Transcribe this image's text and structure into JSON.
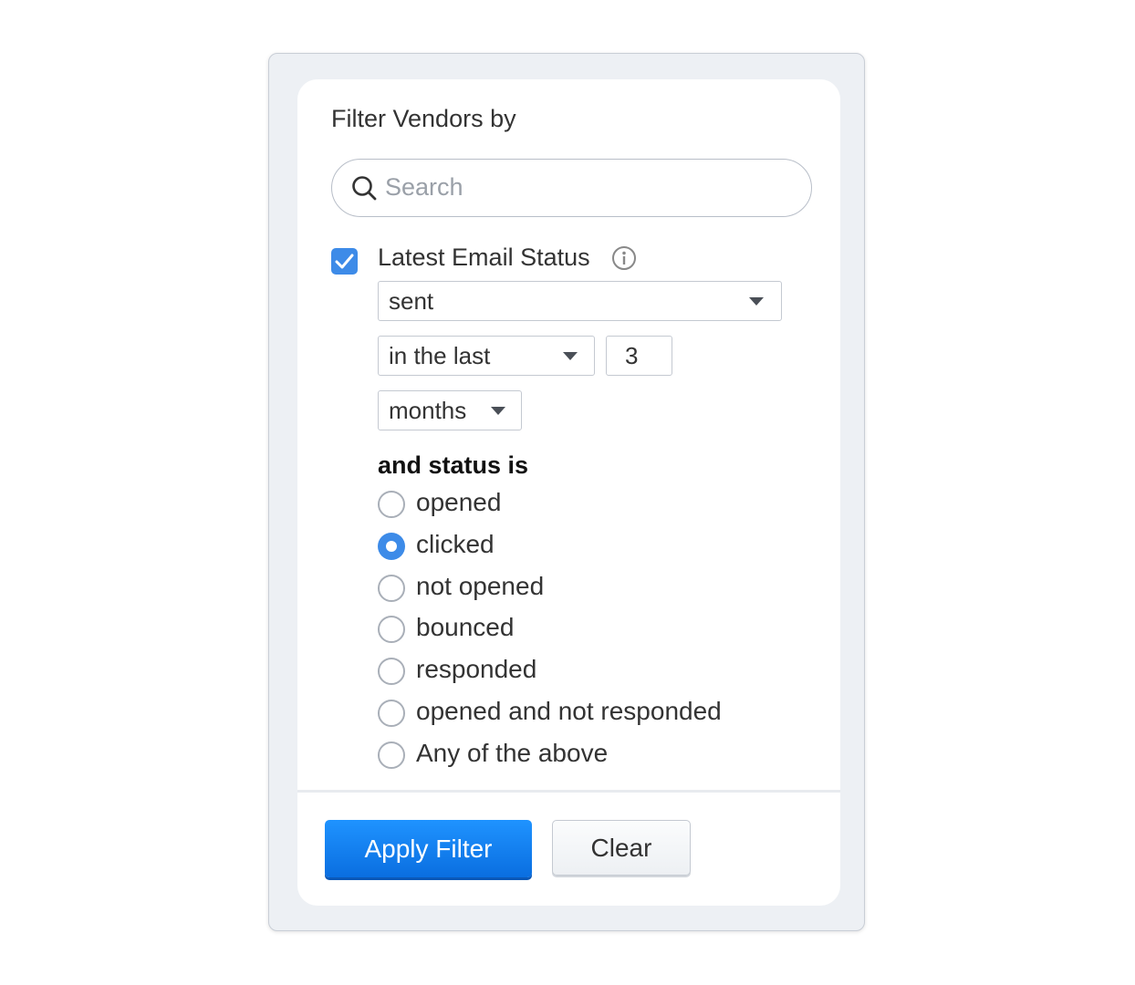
{
  "panel": {
    "title": "Filter Vendors by",
    "search": {
      "placeholder": "Search",
      "value": ""
    },
    "filter": {
      "checked": true,
      "label": "Latest Email Status",
      "status_select": "sent",
      "range_select": "in the last",
      "count_value": "3",
      "unit_select": "months"
    },
    "status_heading": "and status is",
    "status_options": [
      {
        "label": "opened",
        "selected": false
      },
      {
        "label": "clicked",
        "selected": true
      },
      {
        "label": "not opened",
        "selected": false
      },
      {
        "label": "bounced",
        "selected": false
      },
      {
        "label": "responded",
        "selected": false
      },
      {
        "label": "opened and not responded",
        "selected": false
      },
      {
        "label": "Any of the above",
        "selected": false
      }
    ],
    "buttons": {
      "apply": "Apply Filter",
      "clear": "Clear"
    }
  },
  "colors": {
    "accent": "#3d8be8",
    "primary_button": "#1a84f5"
  },
  "icons": {
    "search": "search-icon",
    "info": "info-icon",
    "check": "check-icon",
    "caret": "caret-down-icon"
  }
}
